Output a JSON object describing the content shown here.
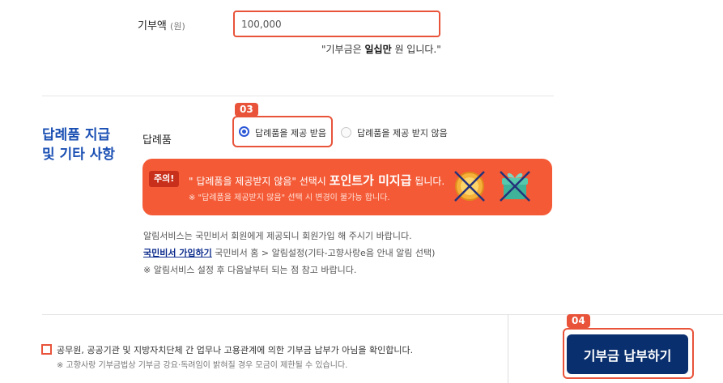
{
  "amount": {
    "label": "기부액",
    "unit": "(원)",
    "value": "100,000",
    "note_prefix": "\"기부금은 ",
    "note_bold": "일십만",
    "note_suffix": " 원 입니다.\""
  },
  "section": {
    "title_line1": "답례품 지급",
    "title_line2": "및 기타 사항"
  },
  "gift": {
    "label": "답례품",
    "step_badge": "03",
    "option_receive": "답례품을 제공 받음",
    "option_decline": "답례품을 제공 받지 않음",
    "selected": "receive"
  },
  "warning": {
    "tag": "주의!",
    "main_quote": "\" 답례품을 제공받지 않음\" ",
    "main_mid": "선택시 ",
    "main_bold": "포인트가 미지급",
    "main_end": " 됩니다.",
    "sub": "※ \"답례품을 제공받지 않음\" 선택 시 변경이 불가능 합니다.",
    "icons": [
      "coin-crossed-icon",
      "gift-crossed-icon"
    ]
  },
  "notice": {
    "line1": "알림서비스는 국민비서 회원에게 제공되니 회원가입 해 주시기 바랍니다.",
    "link": "국민비서 가입하기",
    "line2": " 국민비서 홈 > 알림설정(기타-고향사랑e음 안내 알림 선택)",
    "line3": "※ 알림서비스 설정 후 다음날부터 되는 점 참고 바랍니다."
  },
  "confirm": {
    "text": "공무원, 공공기관 및 지방자치단체 간 업무나 고용관계에 의한 기부금 납부가 아님을 확인합니다.",
    "sub": "※ 고향사랑 기부금법상 기부금 강요·독려임이 밝혀질 경우 모금이 제한될 수 있습니다."
  },
  "pay": {
    "step_badge": "04",
    "label": "기부금 납부하기"
  },
  "colors": {
    "accent": "#e8533a",
    "banner": "#f45a36",
    "primary": "#0a2f6e",
    "title": "#1a4fb3"
  }
}
